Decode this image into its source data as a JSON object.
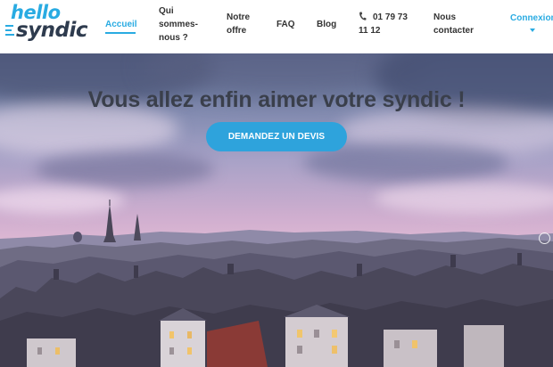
{
  "brand": {
    "logo_line1": "hello",
    "logo_line2": "syndic",
    "colors": {
      "primary": "#29abe2",
      "dark": "#2e3b4e",
      "cta": "#2ea3dc"
    }
  },
  "nav": {
    "home": "Accueil",
    "about_line1": "Qui",
    "about_line2": "sommes-",
    "about_line3": "nous ?",
    "offer_line1": "Notre",
    "offer_line2": "offre",
    "faq": "FAQ",
    "blog": "Blog",
    "phone_line1": "01 79 73",
    "phone_line2": "11 12",
    "contact_line1": "Nous",
    "contact_line2": "contacter",
    "login": "Connexion",
    "phone_icon": "phone-icon",
    "login_caret_icon": "caret-down-icon"
  },
  "hero": {
    "title": "Vous allez enfin aimer votre syndic !",
    "cta_label": "DEMANDEZ UN DEVIS",
    "background": "paris-rooftops-sunset-photo"
  }
}
